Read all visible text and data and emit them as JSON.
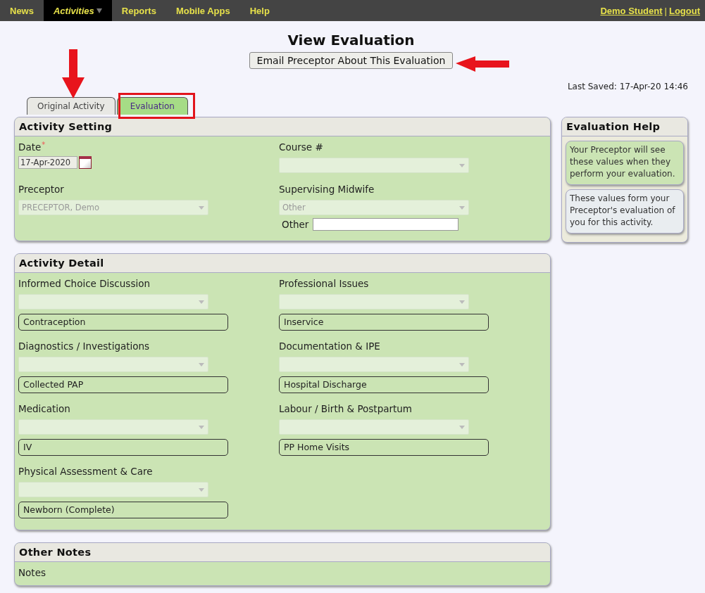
{
  "nav": {
    "items": [
      {
        "label": "News",
        "selected": false,
        "dropdown": false
      },
      {
        "label": "Activities",
        "selected": true,
        "dropdown": true
      },
      {
        "label": "Reports",
        "selected": false,
        "dropdown": false
      },
      {
        "label": "Mobile Apps",
        "selected": false,
        "dropdown": false
      },
      {
        "label": "Help",
        "selected": false,
        "dropdown": false
      }
    ],
    "user": "Demo Student",
    "separator": "|",
    "logout": "Logout"
  },
  "page_title": "View Evaluation",
  "email_button": "Email Preceptor About This Evaluation",
  "last_saved": "Last Saved: 17-Apr-20 14:46",
  "tabs": [
    {
      "label": "Original Activity",
      "selected": false
    },
    {
      "label": "Evaluation",
      "selected": true
    }
  ],
  "activity_setting": {
    "title": "Activity Setting",
    "fields": [
      {
        "kind": "date",
        "label": "Date",
        "required": "*",
        "value": "17-Apr-2020"
      },
      {
        "kind": "select",
        "label": "Course #",
        "disabled": true
      },
      {
        "kind": "select",
        "label": "Preceptor",
        "value": "PRECEPTOR, Demo",
        "disabled": true
      },
      {
        "kind": "select_other",
        "label": "Supervising Midwife",
        "value": "Other",
        "disabled": true,
        "other_label": "Other"
      }
    ]
  },
  "activity_detail": {
    "title": "Activity Detail",
    "fields": [
      {
        "label": "Informed Choice Discussion",
        "disabled": true,
        "chosen": "Contraception"
      },
      {
        "label": "Professional Issues",
        "disabled": true,
        "chosen": "Inservice"
      },
      {
        "label": "Diagnostics / Investigations",
        "disabled": true,
        "chosen": "Collected PAP"
      },
      {
        "label": "Documentation & IPE",
        "disabled": true,
        "chosen": "Hospital Discharge"
      },
      {
        "label": "Medication",
        "disabled": true,
        "chosen": "IV"
      },
      {
        "label": "Labour / Birth & Postpartum",
        "disabled": true,
        "chosen": "PP Home Visits"
      },
      {
        "label": "Physical Assessment & Care",
        "disabled": true,
        "chosen": "Newborn (Complete)"
      }
    ]
  },
  "other_notes": {
    "title": "Other Notes",
    "label": "Notes"
  },
  "help": {
    "title": "Evaluation Help",
    "notes": [
      {
        "kind": "green",
        "text": "Your Preceptor will see these values when they perform your evaluation."
      },
      {
        "kind": "grey",
        "text": "These values form your Preceptor's evaluation of you for this activity."
      }
    ]
  }
}
